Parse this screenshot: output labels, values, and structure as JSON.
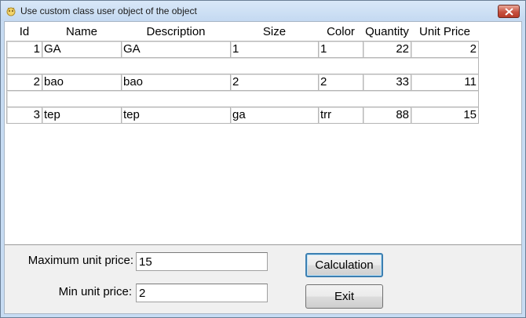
{
  "window": {
    "title": "Use custom class user object of the object",
    "icon": "app-icon",
    "close_icon": "close-icon"
  },
  "table": {
    "columns": [
      "Id",
      "Name",
      "Description",
      "Size",
      "Color",
      "Quantity",
      "Unit Price"
    ],
    "rows": [
      [
        "1",
        "GA",
        "GA",
        "1",
        "1",
        "22",
        "2"
      ],
      [
        "2",
        "bao",
        "bao",
        "2",
        "2",
        "33",
        "11"
      ],
      [
        "3",
        "tep",
        "tep",
        "ga",
        "trr",
        "88",
        "15"
      ]
    ]
  },
  "form": {
    "max_label": "Maximum unit price:",
    "max_value": "15",
    "min_label": "Min unit price:",
    "min_value": "2",
    "calc_label": "Calculation",
    "exit_label": "Exit"
  },
  "colors": {
    "title_bar": "#c4d9f1",
    "close_button": "#c75140",
    "default_button_border": "#3c7fb1"
  }
}
